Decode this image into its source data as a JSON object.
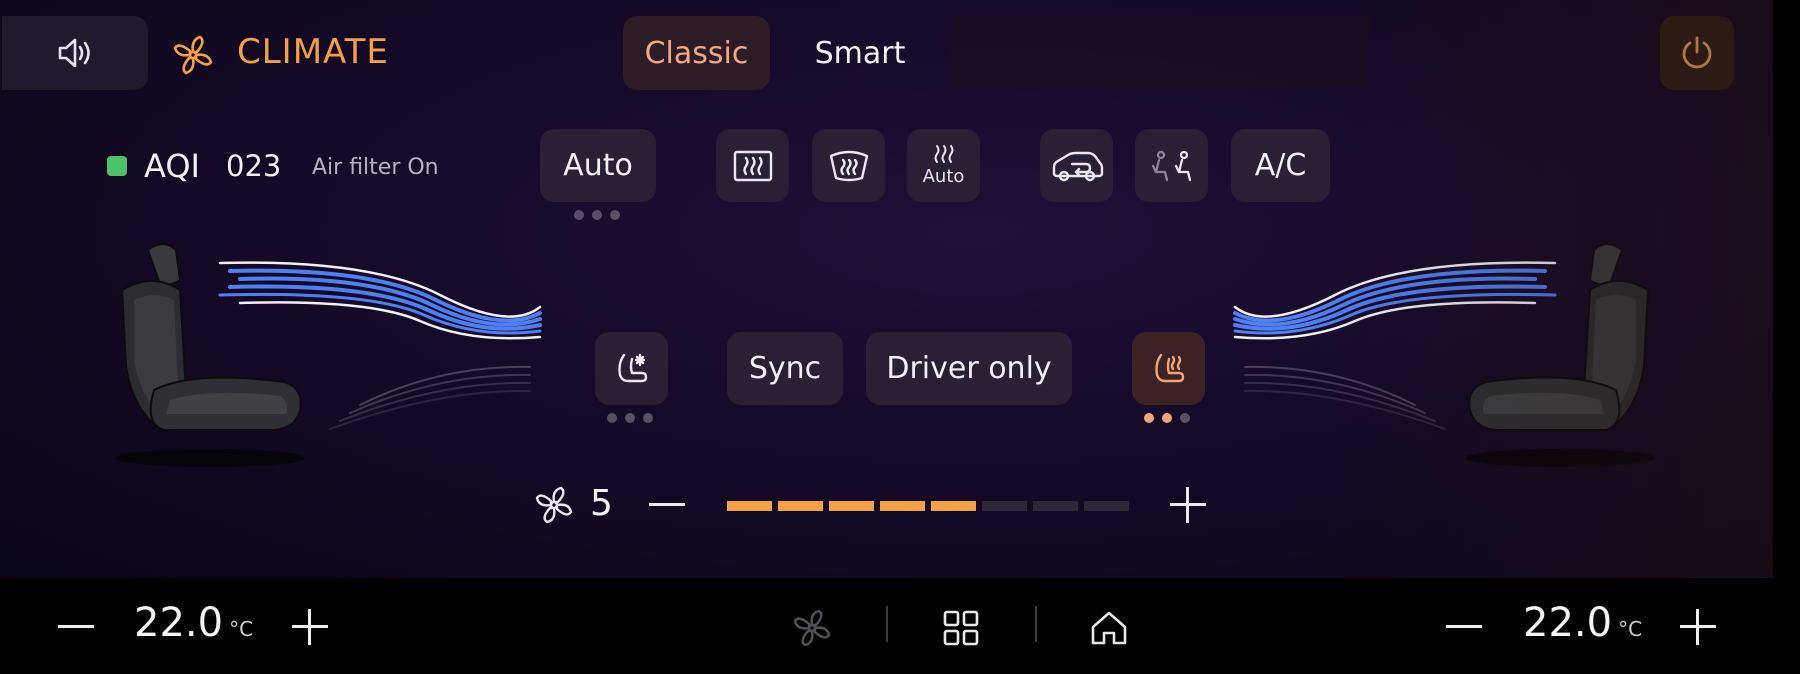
{
  "header": {
    "title": "CLIMATE",
    "mode_tabs": [
      {
        "label": "Classic",
        "active": true
      },
      {
        "label": "Smart",
        "active": false
      }
    ]
  },
  "air": {
    "aqi_label": "AQI",
    "aqi_value": "023",
    "filter_status": "Air filter On",
    "aqi_indicator_color": "#4cc26a"
  },
  "controls": {
    "auto_label": "Auto",
    "rear_defrost_icon": "rear-defrost-icon",
    "front_defrost_icon": "front-defrost-icon",
    "auto_defrost_label": "Auto",
    "recirculation_icon": "air-recirculation-icon",
    "passenger_climate_icon": "passenger-climate-icon",
    "ac_label": "A/C",
    "sync_label": "Sync",
    "driver_only_label": "Driver only",
    "seat_ventilation_icon": "seat-ventilation-icon",
    "seat_heating_icon": "seat-heating-icon",
    "seat_heating_level": 2,
    "seat_heating_max": 3
  },
  "fan": {
    "speed": "5",
    "max": 8,
    "icon": "fan-icon"
  },
  "taskbar": {
    "left_temp": "22.0",
    "right_temp": "22.0",
    "unit": "°C"
  },
  "colors": {
    "accent": "#f5a142",
    "airflow_blue": "#4f7ff0",
    "panel": "#2a1f35",
    "heat_active": "#f3a57a"
  }
}
